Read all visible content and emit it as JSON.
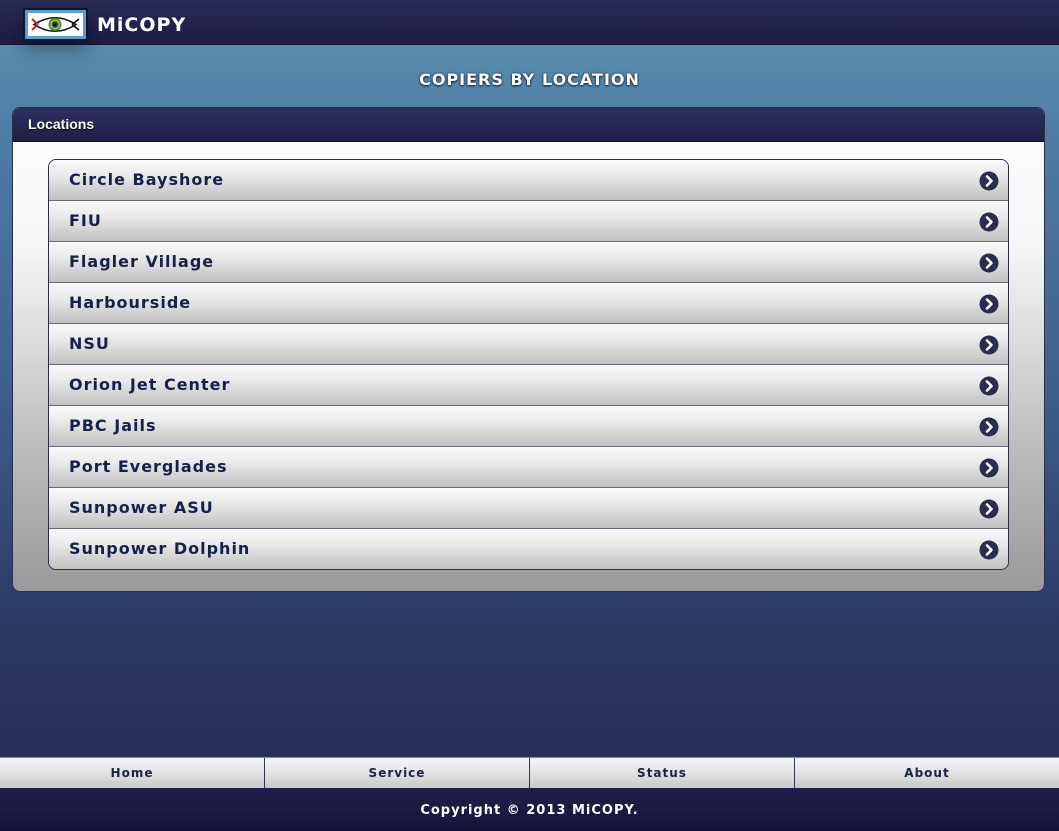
{
  "header": {
    "brand": "MiCOPY",
    "logo_icon": "eye-icon"
  },
  "page_title": "COPIERS BY LOCATION",
  "panel": {
    "header_label": "Locations",
    "items": [
      {
        "label": "Circle Bayshore"
      },
      {
        "label": "FIU"
      },
      {
        "label": "Flagler Village"
      },
      {
        "label": "Harbourside"
      },
      {
        "label": "NSU"
      },
      {
        "label": "Orion Jet Center"
      },
      {
        "label": "PBC Jails"
      },
      {
        "label": "Port Everglades"
      },
      {
        "label": "Sunpower ASU"
      },
      {
        "label": "Sunpower Dolphin"
      }
    ],
    "item_icon": "chevron-right-circle-icon"
  },
  "nav": {
    "items": [
      {
        "label": "Home"
      },
      {
        "label": "Service"
      },
      {
        "label": "Status"
      },
      {
        "label": "About"
      }
    ]
  },
  "footer": {
    "copyright": "Copyright © 2013 MiCOPY."
  },
  "colors": {
    "bar_dark": "#1c1c44",
    "text_navy": "#16204a",
    "background_top": "#5f95b4",
    "background_bottom": "#262e5a"
  }
}
